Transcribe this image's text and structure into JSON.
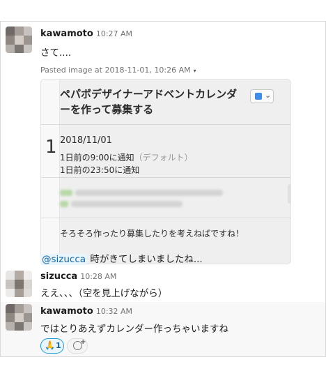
{
  "messages": [
    {
      "author": "kawamoto",
      "time": "10:27 AM",
      "text": "さて....",
      "attachment": {
        "meta": "Pasted image at 2018-11-01, 10:26 AM",
        "caret": "▾",
        "side_digit": "1",
        "title_line1": "ペパボデザイナーアドベントカレンダ",
        "title_line2": "ーを作って募集する",
        "date": "2018/11/01",
        "notice1": "1日前の9:00に通知",
        "notice1_default": "（デフォルト）",
        "notice2": "1日前の23:50に通知",
        "footer": "そろそろ作ったり募集したりを考えねばですね！",
        "calendar_color": "#3e8ee8"
      },
      "followup_mention": "@sizucca",
      "followup_text": " 時がきてしまいましたね..."
    },
    {
      "author": "sizucca",
      "time": "10:28 AM",
      "text": "ええ、、、（空を見上げながら）"
    },
    {
      "author": "kawamoto",
      "time": "10:32 AM",
      "text": "ではとりあえずカレンダー作っちゃいますね",
      "reaction": {
        "emoji": "🙏",
        "count": "1"
      }
    }
  ],
  "colors": {
    "mention_bg": "#e8f5fa",
    "mention_fg": "#1264a3",
    "reaction_border": "#1d9bd1"
  }
}
